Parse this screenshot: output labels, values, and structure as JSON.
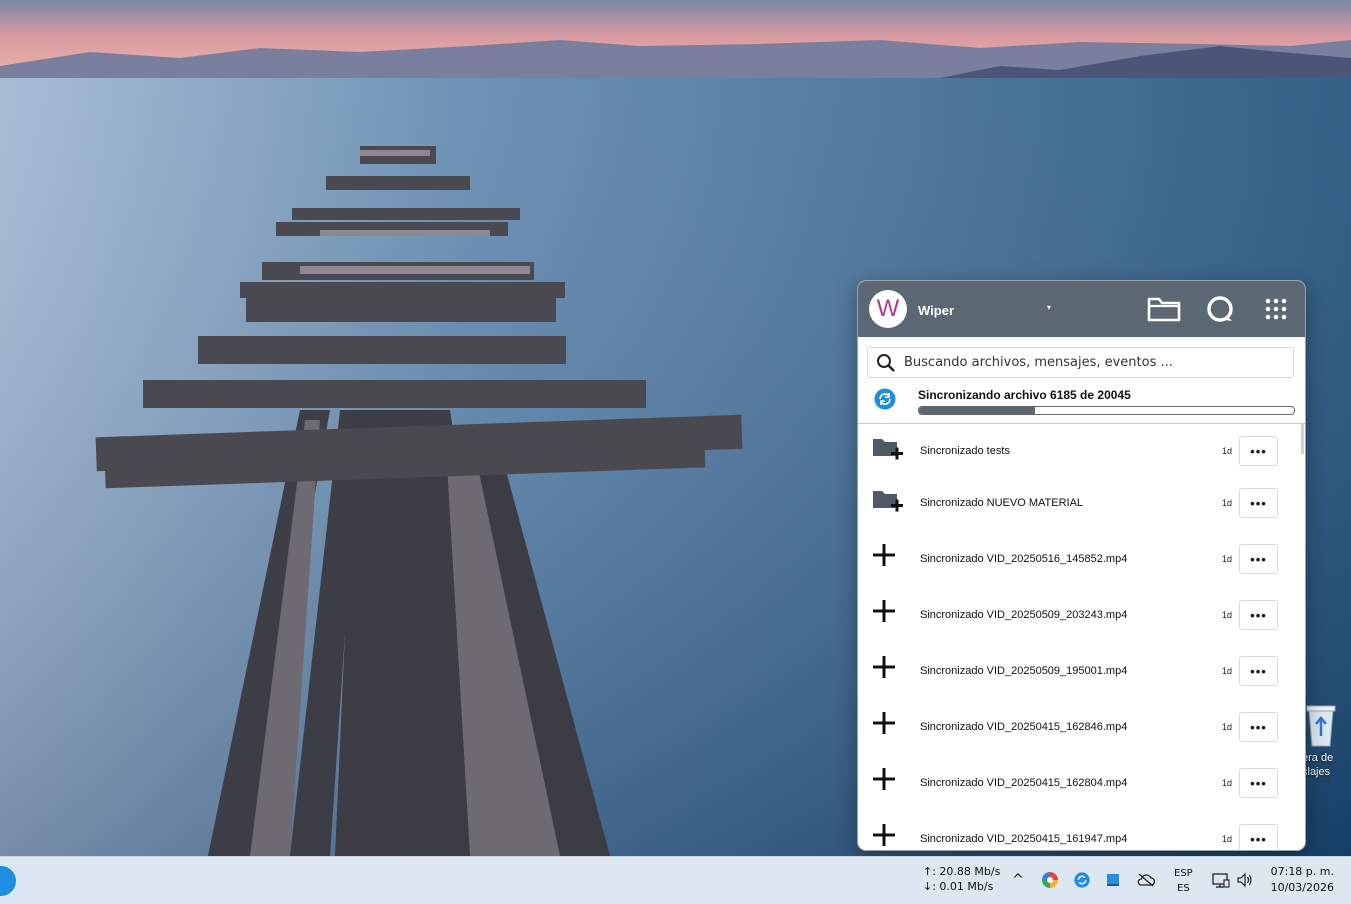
{
  "desktop": {
    "recycle_bin_label_line1": "era de",
    "recycle_bin_label_line2": "clajes"
  },
  "popup": {
    "account": {
      "avatar_letter": "W",
      "name": "Wiper",
      "dropdown_caret": "▾"
    },
    "header_icons": [
      "folder-icon",
      "talk-icon",
      "apps-grid-icon"
    ],
    "search": {
      "placeholder": "Buscando archivos, mensajes, eventos ..."
    },
    "sync_status": {
      "text": "Sincronizando archivo 6185 de 20045",
      "progress_fraction": 0.31
    },
    "activities": [
      {
        "icon": "folder-add-icon",
        "text": "Sincronizado tests",
        "time": "1d",
        "more": "•••"
      },
      {
        "icon": "folder-add-icon",
        "text": "Sincronizado NUEVO MATERIAL",
        "time": "1d",
        "more": "•••"
      },
      {
        "icon": "plus-icon",
        "text": "Sincronizado VID_20250516_145852.mp4",
        "time": "1d",
        "more": "•••"
      },
      {
        "icon": "plus-icon",
        "text": "Sincronizado VID_20250509_203243.mp4",
        "time": "1d",
        "more": "•••"
      },
      {
        "icon": "plus-icon",
        "text": "Sincronizado VID_20250509_195001.mp4",
        "time": "1d",
        "more": "•••"
      },
      {
        "icon": "plus-icon",
        "text": "Sincronizado VID_20250415_162846.mp4",
        "time": "1d",
        "more": "•••"
      },
      {
        "icon": "plus-icon",
        "text": "Sincronizado VID_20250415_162804.mp4",
        "time": "1d",
        "more": "•••"
      },
      {
        "icon": "plus-icon",
        "text": "Sincronizado VID_20250415_161947.mp4",
        "time": "1d",
        "more": "•••"
      }
    ]
  },
  "taskbar": {
    "upload_speed": "↑: 20.88 Mb/s",
    "download_speed": "↓: 0.01 Mb/s",
    "tray_overflow": "^",
    "lang_primary": "ESP",
    "lang_secondary": "ES",
    "time": "07:18 p. m.",
    "date": "10/03/2026"
  },
  "colors": {
    "header": "#5b6773",
    "avatar_letter": "#b03a8e",
    "sync_blue": "#1d8fe3",
    "taskbar": "#dde7f1"
  }
}
